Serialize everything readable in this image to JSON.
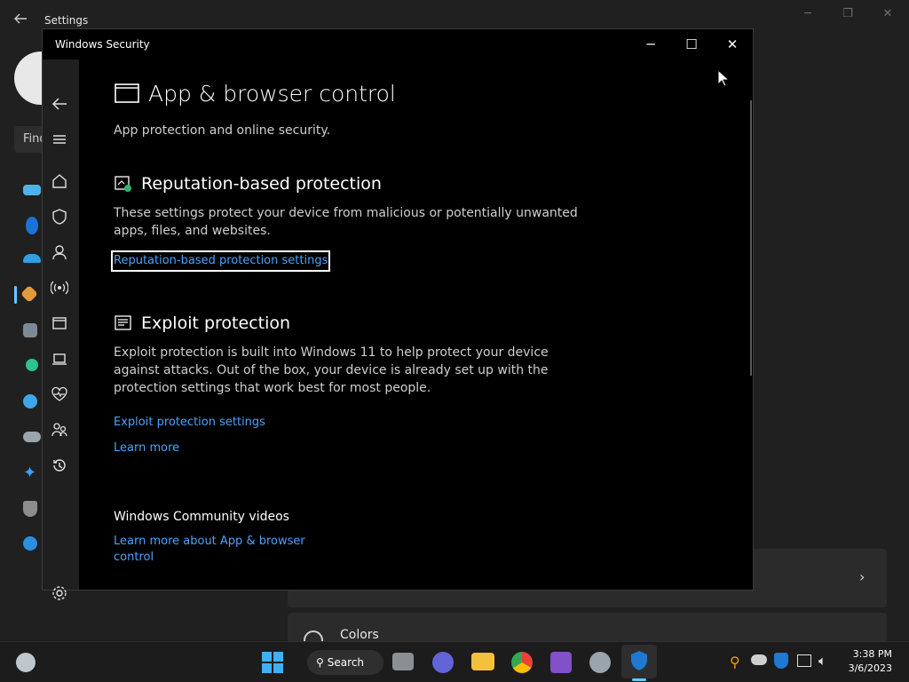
{
  "settings_bg": {
    "title": "Settings",
    "search_placeholder": "Find",
    "card_colors_label": "Colors"
  },
  "security_window": {
    "title": "Windows Security",
    "controls": {
      "minimize": "─",
      "maximize": "☐",
      "close": "✕"
    },
    "page": {
      "title": "App & browser control",
      "subtitle": "App protection and online security.",
      "reputation": {
        "heading": "Reputation-based protection",
        "description_line1": "These settings protect your device from malicious or potentially unwanted",
        "description_line2": "apps, files, and websites.",
        "link": "Reputation-based protection settings"
      },
      "exploit": {
        "heading": "Exploit protection",
        "description_line1": "Exploit protection is built into Windows 11 to help protect your device",
        "description_line2": "against attacks.  Out of the box, your device is already set up with the",
        "description_line3": "protection settings that work best for most people.",
        "link": "Exploit protection settings",
        "learn_more": "Learn more"
      },
      "community": {
        "heading": "Windows Community videos",
        "link_line1": "Learn more about App & browser",
        "link_line2": "control"
      }
    }
  },
  "taskbar": {
    "search_label": "Search",
    "time": "3:38 PM",
    "date": "3/6/2023"
  },
  "colors": {
    "accent": "#4aa3ff",
    "window_bg": "#000000",
    "sidebar_bg": "#1f1f1f"
  }
}
